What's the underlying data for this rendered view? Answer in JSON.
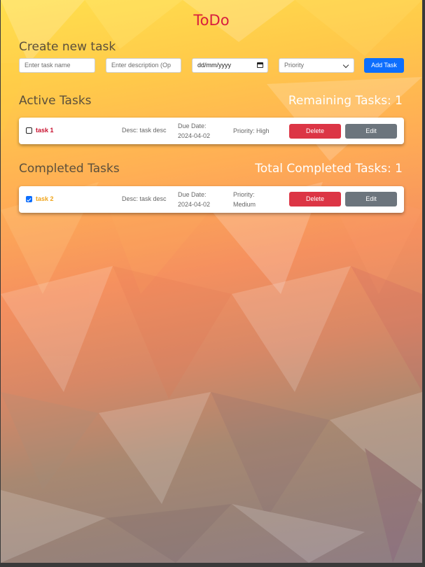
{
  "app": {
    "title": "ToDo"
  },
  "create": {
    "heading": "Create new task",
    "name_placeholder": "Enter task name",
    "desc_placeholder": "Enter description (Op",
    "date_placeholder": "dd/mm/yyyy",
    "priority_selected": "Priority",
    "add_label": "Add Task"
  },
  "active": {
    "heading": "Active Tasks",
    "count_label": "Remaining Tasks: 1",
    "tasks": [
      {
        "name": "task 1",
        "desc": "Desc: task desc",
        "due_label": "Due Date:",
        "due_date": "2024-04-02",
        "priority_line1": "Priority: High",
        "priority_line2": "",
        "checked": false,
        "name_color": "#c8102e",
        "delete_label": "Delete",
        "edit_label": "Edit"
      }
    ]
  },
  "completed": {
    "heading": "Completed Tasks",
    "count_label": "Total Completed Tasks: 1",
    "tasks": [
      {
        "name": "task 2",
        "desc": "Desc: task desc",
        "due_label": "Due Date:",
        "due_date": "2024-04-02",
        "priority_line1": "Priority:",
        "priority_line2": "Medium",
        "checked": true,
        "name_color": "#f0a51c",
        "delete_label": "Delete",
        "edit_label": "Edit"
      }
    ]
  },
  "colors": {
    "title": "#d81e3f",
    "primary": "#0d6efd",
    "danger": "#dc3545",
    "secondary": "#6c757d"
  },
  "icons": {
    "date": "calendar-icon",
    "select": "chevron-down-icon",
    "check": "checkbox-icon"
  }
}
